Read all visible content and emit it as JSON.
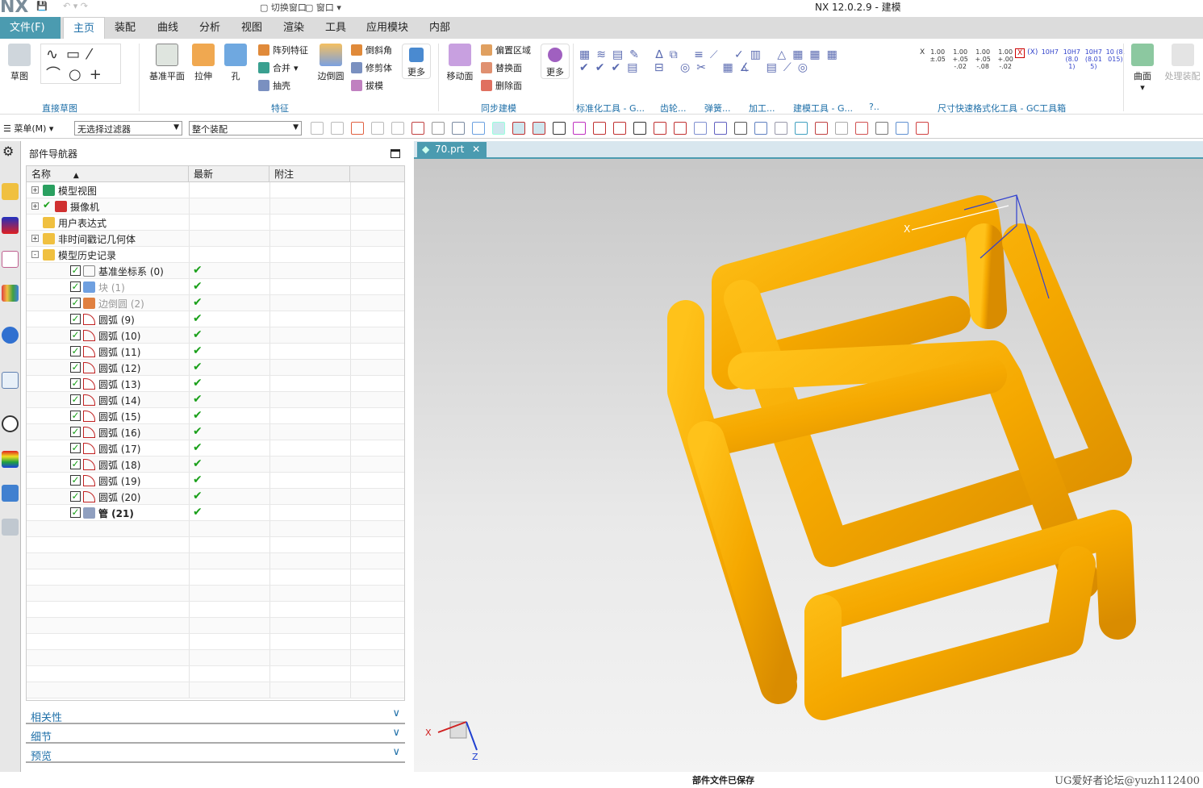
{
  "app": {
    "logo": "NX",
    "title": "NX 12.0.2.9 - 建模",
    "quick_access": {
      "switch_window": "切换窗口",
      "window": "窗口"
    }
  },
  "menu_tabs": [
    "文件(F)",
    "主页",
    "装配",
    "曲线",
    "分析",
    "视图",
    "渲染",
    "工具",
    "应用模块",
    "内部"
  ],
  "active_tab": "主页",
  "ribbon": {
    "sketch": "草图",
    "datum_plane": "基准平面",
    "extrude": "拉伸",
    "hole": "孔",
    "pattern": "阵列特征",
    "unite": "合并",
    "shell": "抽壳",
    "edge_blend": "边倒圆",
    "chamfer": "倒斜角",
    "trim_body": "修剪体",
    "draft": "拔模",
    "more1": "更多",
    "move_face": "移动面",
    "offset_region": "偏置区域",
    "replace_face": "替换面",
    "delete_face": "删除面",
    "more2": "更多",
    "surface": "曲面",
    "process_assembly": "处理装配",
    "dim_labels": [
      "1.00 ±.05",
      "1.00 +.05 -.02",
      "1.00 +.05 -.08",
      "1.00 +.00 -.02",
      "10H7",
      "10H7 (8.01)",
      "10H7 (8.015)",
      "10 (8.015)"
    ],
    "groups": [
      "直接草图",
      "特征",
      "同步建模",
      "标准化工具 - G...",
      "齿轮...",
      "弹簧...",
      "加工...",
      "建模工具 - G...",
      "?..",
      "尺寸快速格式化工具 - GC工具箱"
    ]
  },
  "toolbar": {
    "menu": "菜单(M)",
    "filter": "无选择过滤器",
    "scope": "整个装配"
  },
  "navigator": {
    "title": "部件导航器",
    "columns": [
      "名称",
      "最新",
      "附注"
    ],
    "rows": [
      {
        "name": "模型视图",
        "level": 0,
        "expand": "+",
        "icon": "model-views-icon"
      },
      {
        "name": "摄像机",
        "level": 0,
        "expand": "+",
        "icon": "camera-icon",
        "check": true
      },
      {
        "name": "用户表达式",
        "level": 0,
        "icon": "folder-icon"
      },
      {
        "name": "非时间戳记几何体",
        "level": 0,
        "expand": "+",
        "icon": "folder-icon"
      },
      {
        "name": "模型历史记录",
        "level": 0,
        "expand": "-",
        "icon": "folder-open-icon"
      },
      {
        "name": "基准坐标系 (0)",
        "level": 1,
        "icon": "datum-csys-icon",
        "latest": true
      },
      {
        "name": "块 (1)",
        "level": 1,
        "icon": "block-icon",
        "latest": true,
        "dim": true
      },
      {
        "name": "边倒圆 (2)",
        "level": 1,
        "icon": "edge-blend-icon",
        "latest": true,
        "dim": true
      },
      {
        "name": "圆弧 (9)",
        "level": 1,
        "icon": "arc-icon",
        "latest": true
      },
      {
        "name": "圆弧 (10)",
        "level": 1,
        "icon": "arc-icon",
        "latest": true
      },
      {
        "name": "圆弧 (11)",
        "level": 1,
        "icon": "arc-icon",
        "latest": true
      },
      {
        "name": "圆弧 (12)",
        "level": 1,
        "icon": "arc-icon",
        "latest": true
      },
      {
        "name": "圆弧 (13)",
        "level": 1,
        "icon": "arc-icon",
        "latest": true
      },
      {
        "name": "圆弧 (14)",
        "level": 1,
        "icon": "arc-icon",
        "latest": true
      },
      {
        "name": "圆弧 (15)",
        "level": 1,
        "icon": "arc-icon",
        "latest": true
      },
      {
        "name": "圆弧 (16)",
        "level": 1,
        "icon": "arc-icon",
        "latest": true
      },
      {
        "name": "圆弧 (17)",
        "level": 1,
        "icon": "arc-icon",
        "latest": true
      },
      {
        "name": "圆弧 (18)",
        "level": 1,
        "icon": "arc-icon",
        "latest": true
      },
      {
        "name": "圆弧 (19)",
        "level": 1,
        "icon": "arc-icon",
        "latest": true
      },
      {
        "name": "圆弧 (20)",
        "level": 1,
        "icon": "arc-icon",
        "latest": true
      },
      {
        "name": "管 (21)",
        "level": 1,
        "icon": "tube-icon",
        "latest": true,
        "bold": true
      }
    ],
    "panels": [
      "相关性",
      "细节",
      "预览"
    ]
  },
  "viewport": {
    "tab": "70.prt",
    "triad": {
      "x": "X",
      "z": "Z"
    },
    "model_color": "#f5a800"
  },
  "status": {
    "message": "部件文件已保存",
    "watermark": "UG爱好者论坛@yuzh112400"
  }
}
